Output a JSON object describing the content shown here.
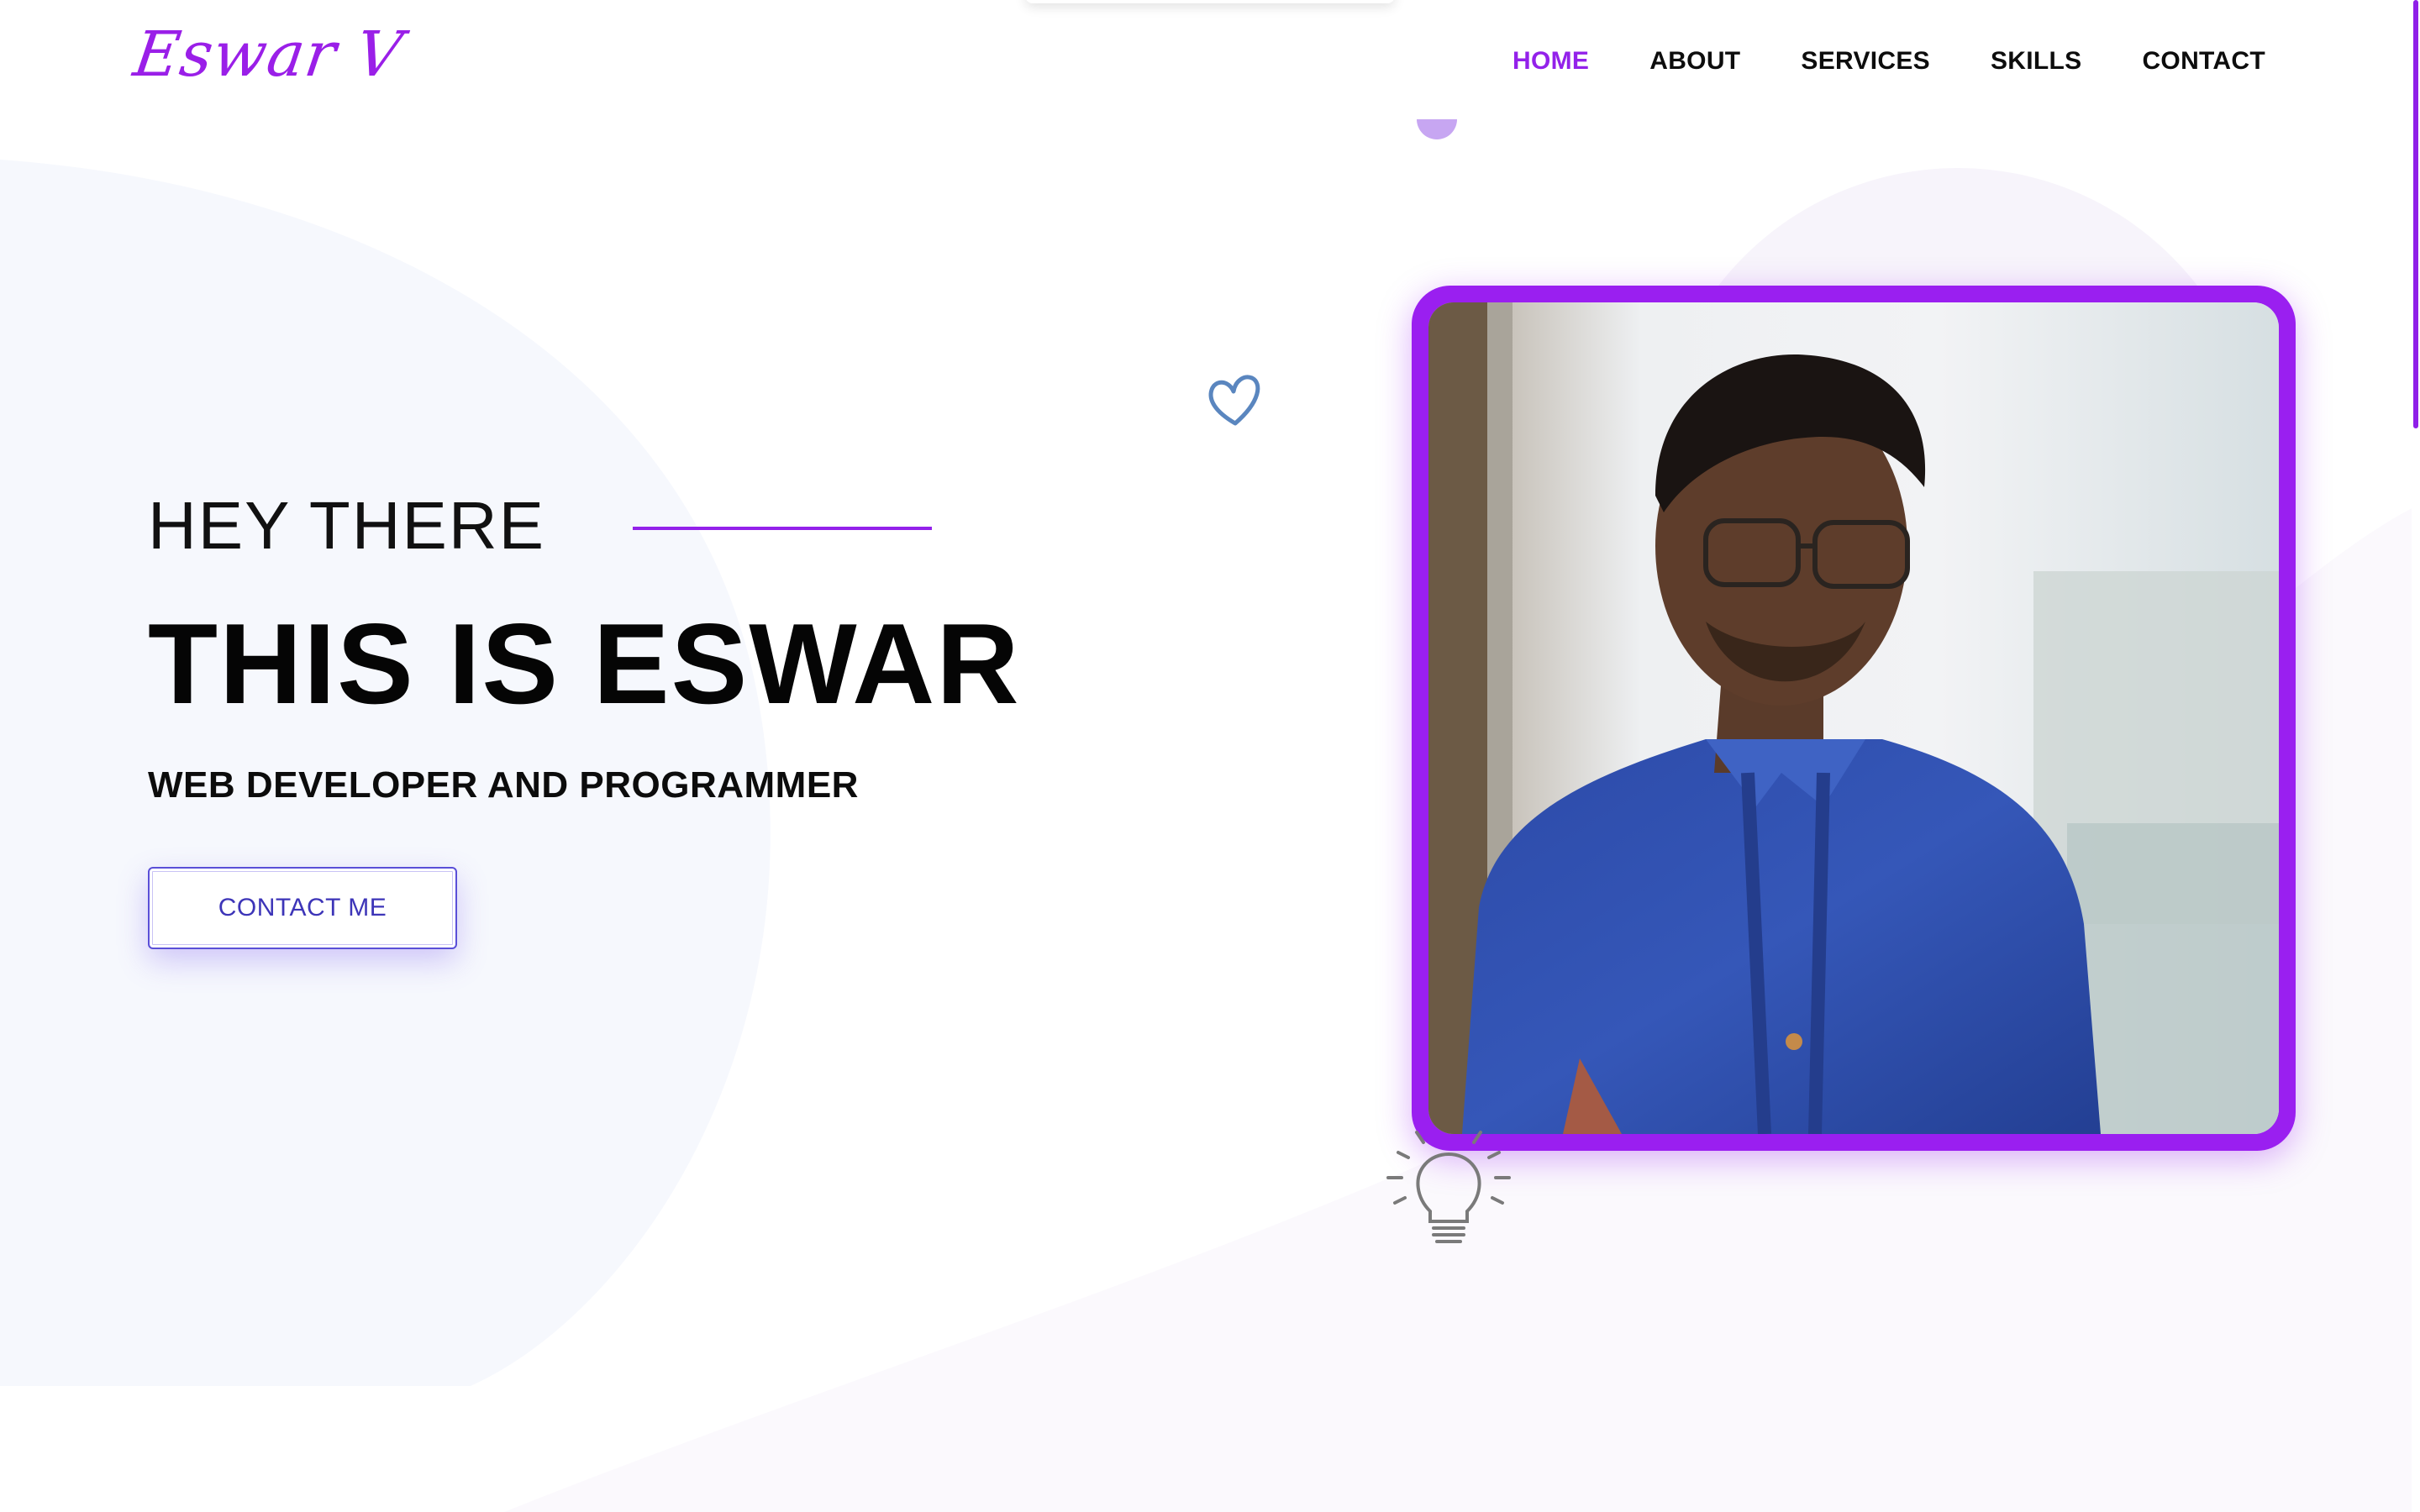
{
  "brand": {
    "logo_text": "Eswar V",
    "accent_color": "#9321ea"
  },
  "nav": {
    "items": [
      {
        "label": "HOME",
        "active": true
      },
      {
        "label": "ABOUT",
        "active": false
      },
      {
        "label": "SERVICES",
        "active": false
      },
      {
        "label": "SKILLS",
        "active": false
      },
      {
        "label": "CONTACT",
        "active": false
      }
    ]
  },
  "hero": {
    "greeting": "HEY THERE",
    "headline": "THIS IS ESWAR",
    "subtitle": "WEB DEVELOPER AND PROGRAMMER",
    "cta_label": "CONTACT ME"
  },
  "photo": {
    "subject": "portrait-photo"
  },
  "decorations": {
    "heart_icon": "heart-icon",
    "bulb_icon": "lightbulb-icon"
  }
}
